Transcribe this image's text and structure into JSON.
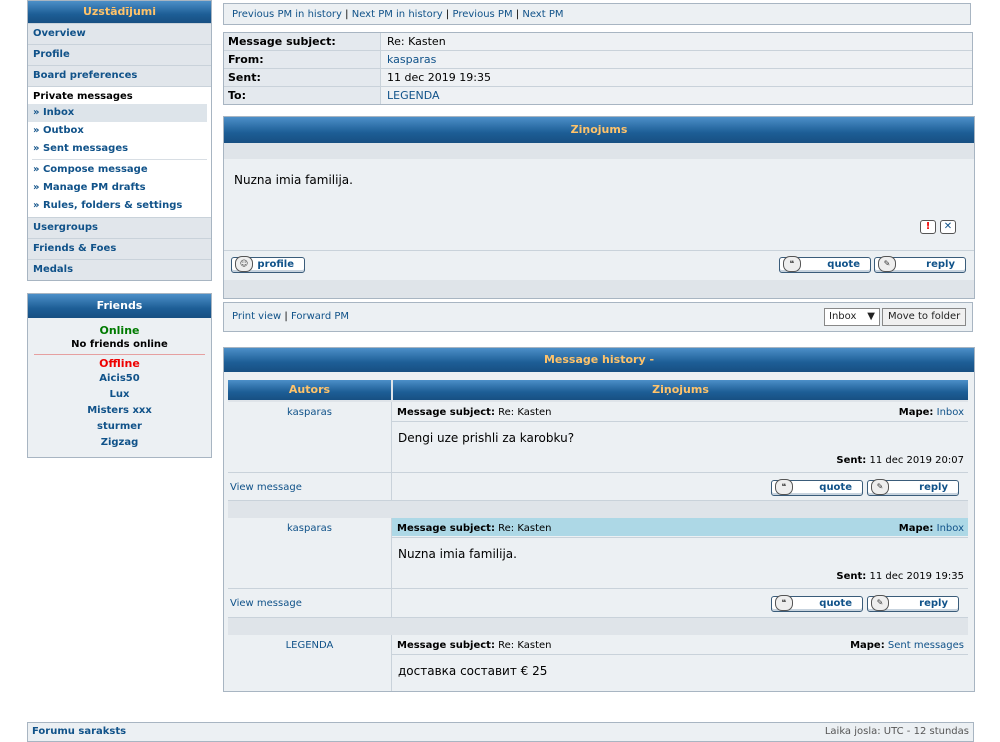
{
  "menu": {
    "title": "Uzstādījumi",
    "items_top": [
      "Overview",
      "Profile",
      "Board preferences"
    ],
    "pm_title": "Private messages",
    "pm_items": [
      "» Inbox",
      "» Outbox",
      "» Sent messages"
    ],
    "pm_items2": [
      "» Compose message",
      "» Manage PM drafts",
      "» Rules, folders & settings"
    ],
    "items_bottom": [
      "Usergroups",
      "Friends & Foes",
      "Medals"
    ]
  },
  "friends": {
    "title": "Friends",
    "online_label": "Online",
    "no_online": "No friends online",
    "offline_label": "Offline",
    "offline_list": [
      "Aicis50",
      "Lux",
      "Misters xxx",
      "sturmer",
      "Zigzag"
    ]
  },
  "nav": {
    "prev_history": "Previous PM in history",
    "next_history": "Next PM in history",
    "prev_pm": "Previous PM",
    "next_pm": "Next PM",
    "sep": "|"
  },
  "message": {
    "subject_label": "Message subject:",
    "subject": "Re: Kasten",
    "from_label": "From:",
    "from": "kasparas",
    "sent_label": "Sent:",
    "sent": "11 dec 2019 19:35",
    "to_label": "To:",
    "to": "LEGENDA",
    "header": "Ziņojums",
    "body": "Nuzna imia familija.",
    "profile_btn": "profile",
    "quote_btn": "quote",
    "reply_btn": "reply"
  },
  "actions": {
    "print_view": "Print view",
    "forward": "Forward PM",
    "folder_select": "Inbox",
    "move_btn": "Move to folder"
  },
  "history": {
    "title": "Message history -",
    "col_author": "Autors",
    "col_message": "Ziņojums",
    "subject_label": "Message subject:",
    "folder_label": "Mape:",
    "sent_label": "Sent:",
    "view_message": "View message",
    "quote_btn": "quote",
    "reply_btn": "reply",
    "entries": [
      {
        "author": "kasparas",
        "subject": "Re: Kasten",
        "folder": "Inbox",
        "body": "Dengi uze prishli za karobku?",
        "sent": "11 dec 2019 20:07"
      },
      {
        "author": "kasparas",
        "subject": "Re: Kasten",
        "folder": "Inbox",
        "body": "Nuzna imia familija.",
        "sent": "11 dec 2019 19:35"
      },
      {
        "author": "LEGENDA",
        "subject": "Re: Kasten",
        "folder": "Sent messages",
        "body": "доставка составит € 25",
        "sent": ""
      }
    ]
  },
  "footer": {
    "left": "Forumu saraksts",
    "right": "Laika josla: UTC - 12 stundas"
  }
}
